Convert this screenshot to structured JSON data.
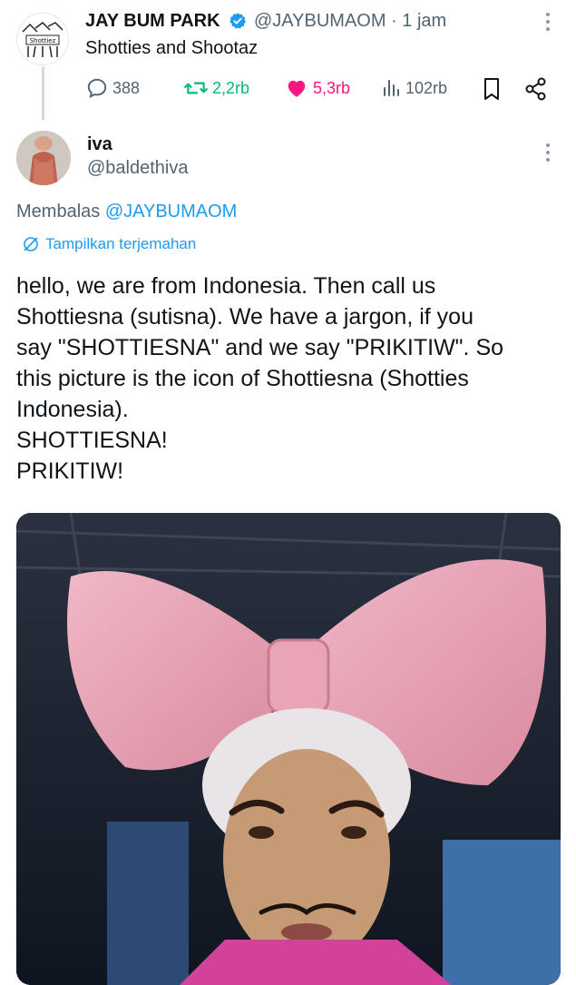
{
  "parent_tweet": {
    "display_name": "JAY BUM PARK",
    "handle": "@JAYBUMAOM",
    "time": "· 1 jam",
    "text": "Shotties and Shootaz",
    "avatar_text": "Shottiez",
    "actions": {
      "replies": "388",
      "reposts": "2,2rb",
      "likes": "5,3rb",
      "views": "102rb"
    }
  },
  "reply_tweet": {
    "display_name": "iva",
    "handle": "@baldethiva",
    "replying_to_prefix": "Membalas",
    "replying_to_handle": "@JAYBUMAOM",
    "translate_label": "Tampilkan terjemahan",
    "body_lines": [
      "hello, we are from Indonesia. Then call us",
      "Shottiesna (sutisna). We have a jargon, if you",
      "say \"SHOTTIESNA\" and we say \"PRIKITIW\". So",
      "this picture is the icon of Shottiesna (Shotties",
      "Indonesia).",
      "SHOTTIESNA!",
      "PRIKITIW!"
    ]
  },
  "colors": {
    "accent": "#1d9bf0",
    "like": "#f91880",
    "secondary_text": "#536471",
    "thread_line": "#cfd9de"
  },
  "icons": [
    "verified-badge-icon",
    "more-icon",
    "reply-icon",
    "repost-icon",
    "like-icon",
    "views-icon",
    "bookmark-icon",
    "share-icon",
    "translate-icon"
  ]
}
